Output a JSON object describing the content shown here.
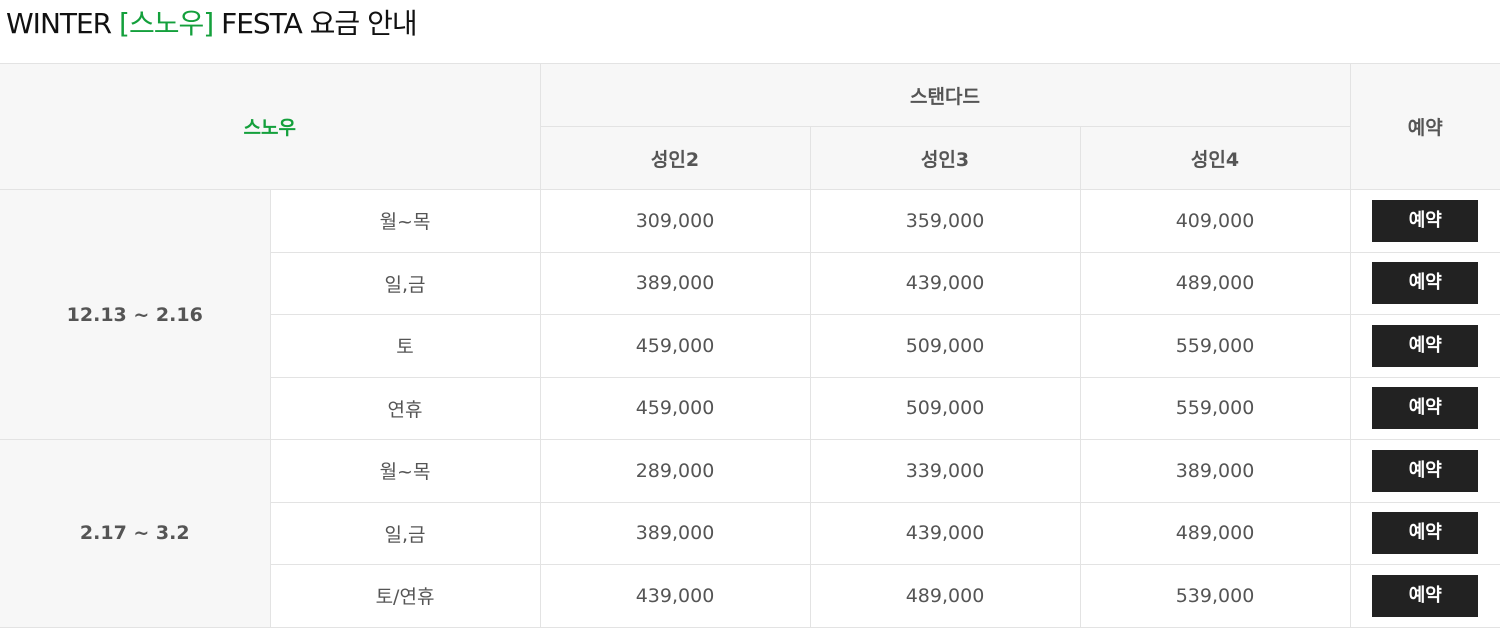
{
  "title": {
    "prefix": "WINTER ",
    "accent": "[스노우]",
    "suffix": " FESTA 요금 안내"
  },
  "table": {
    "brand": "스노우",
    "plan": "스탠다드",
    "reserve_header": "예약",
    "columns": [
      "성인2",
      "성인3",
      "성인4"
    ],
    "button_label": "예약",
    "groups": [
      {
        "period": "12.13 ~ 2.16",
        "rows": [
          {
            "day": "월~목",
            "prices": [
              "309,000",
              "359,000",
              "409,000"
            ]
          },
          {
            "day": "일,금",
            "prices": [
              "389,000",
              "439,000",
              "489,000"
            ]
          },
          {
            "day": "토",
            "prices": [
              "459,000",
              "509,000",
              "559,000"
            ]
          },
          {
            "day": "연휴",
            "prices": [
              "459,000",
              "509,000",
              "559,000"
            ]
          }
        ]
      },
      {
        "period": "2.17 ~ 3.2",
        "rows": [
          {
            "day": "월~목",
            "prices": [
              "289,000",
              "339,000",
              "389,000"
            ]
          },
          {
            "day": "일,금",
            "prices": [
              "389,000",
              "439,000",
              "489,000"
            ]
          },
          {
            "day": "토/연휴",
            "prices": [
              "439,000",
              "489,000",
              "539,000"
            ]
          }
        ]
      }
    ]
  }
}
